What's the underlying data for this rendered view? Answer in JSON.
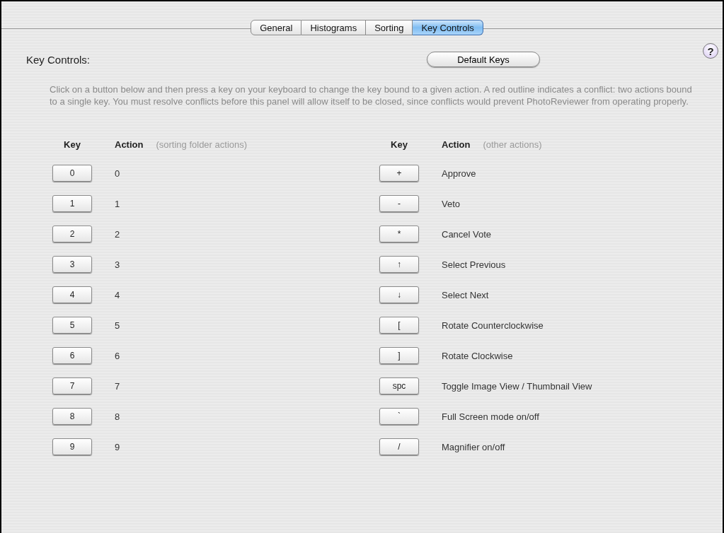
{
  "tabs": [
    {
      "label": "General",
      "selected": false
    },
    {
      "label": "Histograms",
      "selected": false
    },
    {
      "label": "Sorting",
      "selected": false
    },
    {
      "label": "Key Controls",
      "selected": true
    }
  ],
  "help_button": "?",
  "section_title": "Key Controls:",
  "default_keys_button": "Default Keys",
  "description": "Click on a button below and then press a key on your keyboard to change the key bound to a given action. A red outline indicates a conflict: two actions bound to a single key.  You must resolve conflicts before this panel will allow itself to be closed, since conflicts would prevent PhotoReviewer from operating properly.",
  "groups": [
    {
      "key_header": "Key",
      "action_header": "Action",
      "note": "(sorting folder actions)",
      "bindings": [
        {
          "key": "0",
          "action": "0",
          "conflict": false
        },
        {
          "key": "1",
          "action": "1",
          "conflict": false
        },
        {
          "key": "2",
          "action": "2",
          "conflict": false
        },
        {
          "key": "3",
          "action": "3",
          "conflict": false
        },
        {
          "key": "4",
          "action": "4",
          "conflict": false
        },
        {
          "key": "5",
          "action": "5",
          "conflict": false
        },
        {
          "key": "6",
          "action": "6",
          "conflict": false
        },
        {
          "key": "7",
          "action": "7",
          "conflict": false
        },
        {
          "key": "8",
          "action": "8",
          "conflict": false
        },
        {
          "key": "9",
          "action": "9",
          "conflict": false
        }
      ]
    },
    {
      "key_header": "Key",
      "action_header": "Action",
      "note": "(other actions)",
      "bindings": [
        {
          "key": "+",
          "action": "Approve",
          "conflict": false
        },
        {
          "key": "-",
          "action": "Veto",
          "conflict": false
        },
        {
          "key": "*",
          "action": "Cancel Vote",
          "conflict": false
        },
        {
          "key": "↑",
          "action": "Select Previous",
          "conflict": false
        },
        {
          "key": "↓",
          "action": "Select Next",
          "conflict": false
        },
        {
          "key": "[",
          "action": "Rotate Counterclockwise",
          "conflict": false
        },
        {
          "key": "]",
          "action": "Rotate Clockwise",
          "conflict": false
        },
        {
          "key": "spc",
          "action": "Toggle Image View / Thumbnail View",
          "conflict": false
        },
        {
          "key": "`",
          "action": "Full Screen mode on/off",
          "conflict": false
        },
        {
          "key": "/",
          "action": "Magnifier on/off",
          "conflict": false
        }
      ]
    }
  ]
}
